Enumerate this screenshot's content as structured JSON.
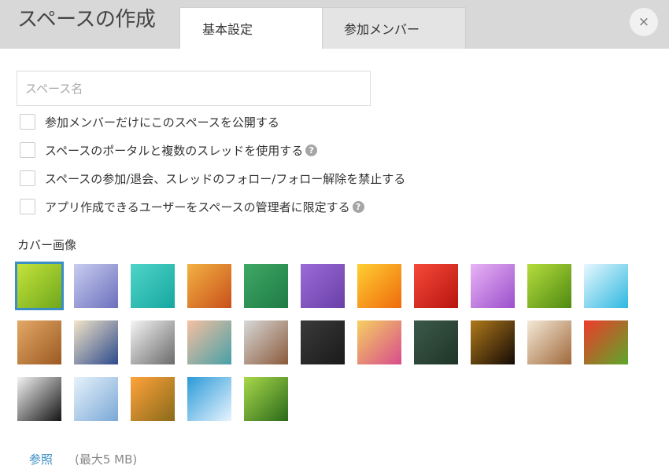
{
  "header": {
    "title": "スペースの作成",
    "tabs": {
      "basic": "基本設定",
      "members": "参加メンバー"
    },
    "close_symbol": "×"
  },
  "form": {
    "name_placeholder": "スペース名",
    "options": [
      {
        "label": "参加メンバーだけにこのスペースを公開する",
        "help": false
      },
      {
        "label": "スペースのポータルと複数のスレッドを使用する",
        "help": true
      },
      {
        "label": "スペースの参加/退会、スレッドのフォロー/フォロー解除を禁止する",
        "help": false
      },
      {
        "label": "アプリ作成できるユーザーをスペースの管理者に限定する",
        "help": true
      }
    ],
    "help_symbol": "?"
  },
  "cover": {
    "label": "カバー画像",
    "browse": "参照",
    "max_size": "(最大5 MB)",
    "selected_index": 0,
    "images": [
      {
        "name": "green-lines",
        "c1": "#c5e33b",
        "c2": "#6fa81c"
      },
      {
        "name": "blue-blur",
        "c1": "#c8cdf0",
        "c2": "#6c70bd"
      },
      {
        "name": "teal-paint",
        "c1": "#4fd4c8",
        "c2": "#16a7a0"
      },
      {
        "name": "orange-texture",
        "c1": "#f3b243",
        "c2": "#c9501a"
      },
      {
        "name": "green-paper",
        "c1": "#3fa865",
        "c2": "#1f7b45"
      },
      {
        "name": "purple-fabric",
        "c1": "#9b6bd6",
        "c2": "#6a3fa8"
      },
      {
        "name": "orange-flower",
        "c1": "#ffcf33",
        "c2": "#ef6a0c"
      },
      {
        "name": "red-carnation",
        "c1": "#f54a3a",
        "c2": "#b8140e"
      },
      {
        "name": "lilac-flower",
        "c1": "#e8b4f5",
        "c2": "#9c4fcc"
      },
      {
        "name": "green-leaf",
        "c1": "#b5dc3d",
        "c2": "#4f8a12"
      },
      {
        "name": "cyan-cubes",
        "c1": "#e8f8ff",
        "c2": "#2eb8e0"
      },
      {
        "name": "wood-weave",
        "c1": "#e3a866",
        "c2": "#9c5a22"
      },
      {
        "name": "moroccan-tile",
        "c1": "#f2e4c8",
        "c2": "#2c4a8c"
      },
      {
        "name": "compass",
        "c1": "#f5f5f5",
        "c2": "#6a6a6a"
      },
      {
        "name": "books",
        "c1": "#f6c0a0",
        "c2": "#47a0a8"
      },
      {
        "name": "tools",
        "c1": "#d8d8d8",
        "c2": "#8a5a3a"
      },
      {
        "name": "chalk-doodles",
        "c1": "#3a3a3a",
        "c2": "#1a1a1a"
      },
      {
        "name": "colored-pencils",
        "c1": "#f6d060",
        "c2": "#d84c8c"
      },
      {
        "name": "chalk-bulbs",
        "c1": "#3c5a48",
        "c2": "#1e3428"
      },
      {
        "name": "dark-gradient",
        "c1": "#b07a1a",
        "c2": "#140a06"
      },
      {
        "name": "latte-art",
        "c1": "#f4ead8",
        "c2": "#a0683a"
      },
      {
        "name": "vegetables",
        "c1": "#ef3a2a",
        "c2": "#5ba82a"
      },
      {
        "name": "cat-peeking",
        "c1": "#f4f4f4",
        "c2": "#141414"
      },
      {
        "name": "snow-trees",
        "c1": "#e6f2fb",
        "c2": "#7aa8d6"
      },
      {
        "name": "pumpkins",
        "c1": "#ffa33a",
        "c2": "#8a6a1a"
      },
      {
        "name": "palm-beach",
        "c1": "#2a9ad8",
        "c2": "#e8f4ff"
      },
      {
        "name": "bamboo",
        "c1": "#a8d84a",
        "c2": "#2a6a1a"
      }
    ]
  }
}
